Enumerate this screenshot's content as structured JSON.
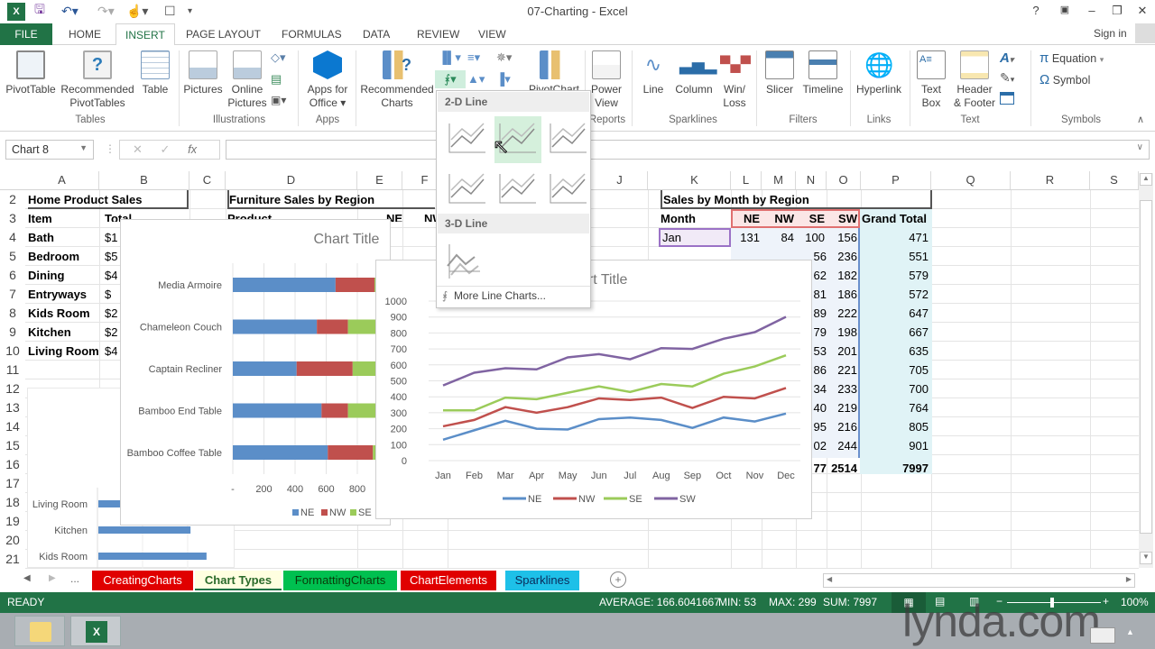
{
  "window": {
    "title": "07-Charting - Excel",
    "help": "?",
    "sign_in": "Sign in"
  },
  "quick_access": {
    "icons": [
      "excel-logo",
      "save",
      "undo",
      "redo",
      "touch-mode",
      "print-preview",
      "customize"
    ]
  },
  "ribbon_tabs": [
    "FILE",
    "HOME",
    "INSERT",
    "PAGE LAYOUT",
    "FORMULAS",
    "DATA",
    "REVIEW",
    "VIEW"
  ],
  "active_tab": "INSERT",
  "ribbon": {
    "pivottable": "PivotTable",
    "recommended_pivottables_1": "Recommended",
    "recommended_pivottables_2": "PivotTables",
    "table": "Table",
    "group_tables": "Tables",
    "pictures": "Pictures",
    "online_pictures_1": "Online",
    "online_pictures_2": "Pictures",
    "group_illustrations": "Illustrations",
    "apps_1": "Apps for",
    "apps_2": "Office",
    "group_apps": "Apps",
    "rec_charts_1": "Recommended",
    "rec_charts_2": "Charts",
    "pivotchart": "PivotChart",
    "power_view_1": "Power",
    "power_view_2": "View",
    "group_reports": "Reports",
    "line": "Line",
    "column": "Column",
    "winloss_1": "Win/",
    "winloss_2": "Loss",
    "group_sparklines": "Sparklines",
    "slicer": "Slicer",
    "timeline": "Timeline",
    "group_filters": "Filters",
    "hyperlink": "Hyperlink",
    "group_links": "Links",
    "textbox_1": "Text",
    "textbox_2": "Box",
    "header_1": "Header",
    "header_2": "& Footer",
    "group_text": "Text",
    "equation": "Equation",
    "symbol": "Symbol",
    "group_symbols": "Symbols"
  },
  "line_dropdown": {
    "section_2d": "2-D Line",
    "section_3d": "3-D Line",
    "more": "More Line Charts...",
    "items_2d": [
      "Line",
      "Stacked Line",
      "100% Stacked Line",
      "Line with Markers",
      "Stacked Line with Markers",
      "100% Stacked Line with Markers"
    ],
    "hovered": "Stacked Line",
    "items_3d": [
      "3-D Line"
    ]
  },
  "formula_bar": {
    "name_box": "Chart 8",
    "fx": "fx",
    "value": ""
  },
  "columns": [
    "A",
    "B",
    "C",
    "D",
    "E",
    "F",
    "J",
    "K",
    "L",
    "M",
    "N",
    "O",
    "P",
    "Q",
    "R",
    "S"
  ],
  "rows": [
    "2",
    "3",
    "4",
    "5",
    "6",
    "7",
    "8",
    "9",
    "10",
    "11",
    "12",
    "13",
    "14",
    "15",
    "16",
    "17",
    "18",
    "19",
    "20",
    "21"
  ],
  "home_sales": {
    "title": "Home Product Sales",
    "headers": [
      "Item",
      "Total"
    ],
    "items": [
      {
        "item": "Bath",
        "total": "$1"
      },
      {
        "item": "Bedroom",
        "total": "$5"
      },
      {
        "item": "Dining",
        "total": "$4"
      },
      {
        "item": "Entryways",
        "total": "$"
      },
      {
        "item": "Kids Room",
        "total": "$2"
      },
      {
        "item": "Kitchen",
        "total": "$2"
      },
      {
        "item": "Living Room",
        "total": "$4"
      }
    ]
  },
  "furniture": {
    "title": "Furniture Sales by Region",
    "headers": [
      "Product",
      "NE",
      "NW"
    ]
  },
  "monthly": {
    "title": "Sales by Month by Region",
    "headers": [
      "Month",
      "NE",
      "NW",
      "SE",
      "SW",
      "Grand Total"
    ],
    "jan": [
      "Jan",
      "131",
      "84",
      "100",
      "156",
      "471"
    ],
    "partial_n": [
      "56",
      "62",
      "81",
      "89",
      "79",
      "53",
      "86",
      "34",
      "40",
      "95",
      "02"
    ],
    "sw": [
      "236",
      "182",
      "186",
      "222",
      "198",
      "201",
      "221",
      "233",
      "219",
      "216",
      "244"
    ],
    "grand": [
      "551",
      "579",
      "572",
      "647",
      "667",
      "635",
      "705",
      "700",
      "764",
      "805",
      "901"
    ],
    "total_row": {
      "o_partial": "77",
      "sw": "2514",
      "grand": "7997"
    }
  },
  "chart_data": [
    {
      "type": "line",
      "stacked": true,
      "title": "Chart Title",
      "x": [
        "Jan",
        "Feb",
        "Mar",
        "Apr",
        "May",
        "Jun",
        "Jul",
        "Aug",
        "Sep",
        "Oct",
        "Nov",
        "Dec"
      ],
      "series": [
        {
          "name": "NE",
          "color": "#5b8ec8",
          "values": [
            131,
            190,
            250,
            200,
            195,
            260,
            270,
            255,
            205,
            270,
            245,
            295
          ]
        },
        {
          "name": "NW",
          "color": "#c0504d",
          "values": [
            84,
            65,
            85,
            100,
            140,
            130,
            110,
            140,
            125,
            130,
            145,
            160
          ]
        },
        {
          "name": "SE",
          "color": "#9bcb5a",
          "values": [
            100,
            60,
            60,
            85,
            90,
            75,
            50,
            85,
            135,
            145,
            200,
            205
          ]
        },
        {
          "name": "SW",
          "color": "#8064a2",
          "values": [
            156,
            236,
            184,
            187,
            222,
            202,
            205,
            225,
            235,
            219,
            215,
            241
          ]
        }
      ],
      "ylim": [
        0,
        1000
      ],
      "yticks": [
        0,
        100,
        200,
        300,
        400,
        500,
        600,
        700,
        800,
        900,
        1000
      ],
      "legend": "bottom",
      "grid": true
    },
    {
      "type": "bar",
      "orientation": "horizontal",
      "stacked": true,
      "title": "Chart Title",
      "categories": [
        "Media Armoire",
        "Chameleon Couch",
        "Captain Recliner",
        "Bamboo End Table",
        "Bamboo Coffee Table"
      ],
      "series": [
        {
          "name": "NE",
          "color": "#5b8ec8",
          "values": [
            660,
            540,
            410,
            570,
            610
          ]
        },
        {
          "name": "NW",
          "color": "#c0504d",
          "values": [
            250,
            200,
            360,
            170,
            290
          ]
        },
        {
          "name": "SE",
          "color": "#9bcb5a",
          "values": [
            150,
            200,
            170,
            180,
            120
          ]
        }
      ],
      "xticks": [
        "-",
        "200",
        "400",
        "600",
        "800"
      ],
      "legend": "bottom"
    },
    {
      "type": "bar",
      "orientation": "horizontal",
      "categories": [
        "Living Room",
        "Kitchen",
        "Kids Room"
      ],
      "values": [
        0.25,
        0.69,
        0.81
      ]
    }
  ],
  "sheet_tabs": [
    {
      "label": "CreatingCharts",
      "bg": "#e00000",
      "fg": "#ffffff"
    },
    {
      "label": "Chart Types",
      "bg": "#ffffe0",
      "fg": "#2a6a2a",
      "active": true
    },
    {
      "label": "FormattingCharts",
      "bg": "#00c050",
      "fg": "#0a3a0a"
    },
    {
      "label": "ChartElements",
      "bg": "#e00000",
      "fg": "#ffffff"
    },
    {
      "label": "Sparklines",
      "bg": "#1ec0e8",
      "fg": "#0a2a5a"
    }
  ],
  "sheet_nav_more": "...",
  "status": {
    "ready": "READY",
    "average": "AVERAGE: 166.6041667",
    "min": "MIN: 53",
    "max": "MAX: 299",
    "sum": "SUM: 7997",
    "zoom": "100%"
  },
  "watermark": "lynda.com",
  "colors": {
    "excel_green": "#217346",
    "accent_hover": "#d5f0dc"
  }
}
